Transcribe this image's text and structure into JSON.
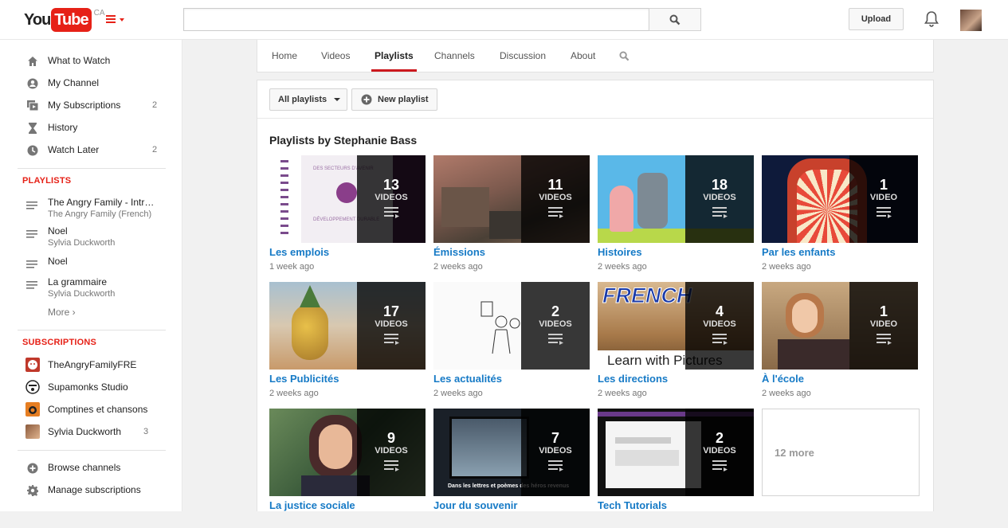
{
  "header": {
    "logo_you": "You",
    "logo_tube": "Tube",
    "region": "CA",
    "search_placeholder": "",
    "upload_label": "Upload"
  },
  "sidebar": {
    "nav": [
      {
        "label": "What to Watch",
        "icon": "home-icon",
        "count": ""
      },
      {
        "label": "My Channel",
        "icon": "person-icon",
        "count": ""
      },
      {
        "label": "My Subscriptions",
        "icon": "subscriptions-icon",
        "count": "2"
      },
      {
        "label": "History",
        "icon": "hourglass-icon",
        "count": ""
      },
      {
        "label": "Watch Later",
        "icon": "clock-icon",
        "count": "2"
      }
    ],
    "playlists_heading": "PLAYLISTS",
    "playlists": [
      {
        "title": "The Angry Family - Intr…",
        "owner": "The Angry Family (French)"
      },
      {
        "title": "Noel",
        "owner": "Sylvia Duckworth"
      },
      {
        "title": "Noel",
        "owner": ""
      },
      {
        "title": "La grammaire",
        "owner": "Sylvia Duckworth"
      }
    ],
    "more_label": "More ›",
    "subscriptions_heading": "SUBSCRIPTIONS",
    "subscriptions": [
      {
        "name": "TheAngryFamilyFRE",
        "count": "",
        "color": "#c0392b"
      },
      {
        "name": "Supamonks Studio",
        "count": "",
        "color": "#222222"
      },
      {
        "name": "Comptines et chansons",
        "count": "",
        "color": "#e67e22"
      },
      {
        "name": "Sylvia Duckworth",
        "count": "3",
        "color": "#a0522d"
      }
    ],
    "footer": [
      {
        "label": "Browse channels",
        "icon": "plus-circle-icon"
      },
      {
        "label": "Manage subscriptions",
        "icon": "gear-icon"
      }
    ]
  },
  "tabs": {
    "items": [
      "Home",
      "Videos",
      "Playlists",
      "Channels",
      "Discussion",
      "About"
    ],
    "active": "Playlists"
  },
  "toolbar": {
    "filter_label": "All playlists",
    "new_playlist_label": "New playlist"
  },
  "section_title": "Playlists by Stephanie Bass",
  "playlists": [
    {
      "title": "Les emplois",
      "count": "13",
      "unit": "VIDEOS",
      "date": "1 week ago"
    },
    {
      "title": "Émissions",
      "count": "11",
      "unit": "VIDEOS",
      "date": "2 weeks ago"
    },
    {
      "title": "Histoires",
      "count": "18",
      "unit": "VIDEOS",
      "date": "2 weeks ago"
    },
    {
      "title": "Par les enfants",
      "count": "1",
      "unit": "VIDEO",
      "date": "2 weeks ago"
    },
    {
      "title": "Les Publicités",
      "count": "17",
      "unit": "VIDEOS",
      "date": "2 weeks ago"
    },
    {
      "title": "Les actualités",
      "count": "2",
      "unit": "VIDEOS",
      "date": "2 weeks ago"
    },
    {
      "title": "Les directions",
      "count": "4",
      "unit": "VIDEOS",
      "date": "2 weeks ago"
    },
    {
      "title": "À l'école",
      "count": "1",
      "unit": "VIDEO",
      "date": "2 weeks ago"
    },
    {
      "title": "La justice sociale",
      "count": "9",
      "unit": "VIDEOS",
      "date": ""
    },
    {
      "title": "Jour du souvenir",
      "count": "7",
      "unit": "VIDEOS",
      "date": ""
    },
    {
      "title": "Tech Tutorials",
      "count": "2",
      "unit": "VIDEOS",
      "date": ""
    }
  ],
  "thumb_text": {
    "emplois_a": "DES SECTEURS D'AVENIR",
    "emplois_b": "DÉVELOPPEMENT DURABLE",
    "directions_a": "FRENCH",
    "directions_b": "Learn with Pictures",
    "souvenir": "Dans les lettres et poèmes des héros revenus"
  },
  "more_card_label": "12 more"
}
